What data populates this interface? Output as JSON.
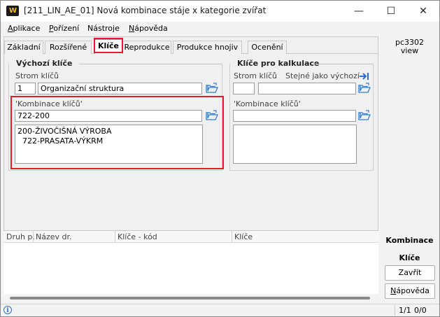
{
  "window": {
    "title": "[211_LIN_AE_01] Nová kombinace stáje x kategorie zvířat",
    "logo": "W",
    "minimize_glyph": "—",
    "maximize_glyph": "☐",
    "close_glyph": "✕"
  },
  "menu": {
    "aplikace": {
      "ul": "A",
      "rest": "plikace"
    },
    "porizeni": {
      "ul": "P",
      "rest": "ořízení"
    },
    "nastroje": {
      "pre": "Nástro",
      "ul": "j",
      "rest": "e"
    },
    "napoveda": {
      "ul": "N",
      "rest": "ápověda"
    }
  },
  "tabs": [
    "Základní",
    "Rozšířené",
    "Klíče",
    "Reprodukce",
    "Produkce hnojiv",
    "Ocenění"
  ],
  "vychozi": {
    "title": "Výchozí klíče",
    "strom_label": "Strom klíčů",
    "strom_code": "1",
    "strom_name": "Organizační struktura",
    "kombinace_label": "'Kombinace klíčů'",
    "kombinace_value": "722-200",
    "kombinace_tree": "200-ŽIVOČIŠNÁ VÝROBA\n  722-PRASATA-VÝKRM"
  },
  "kalkulace": {
    "title": "Klíče pro kalkulace",
    "strom_label": "Strom klíčů",
    "stejne_label": "Stejné jako výchozí",
    "strom_code": "",
    "strom_name": "",
    "kombinace_label": "'Kombinace klíčů'",
    "kombinace_value": "",
    "kombinace_tree": ""
  },
  "table": {
    "columns": [
      "Druh p.",
      "Název dr.",
      "Klíče - kód",
      "Klíče"
    ]
  },
  "side": {
    "user": "pc3302",
    "view": "view",
    "section": "Kombinace",
    "subsection": "Klíče",
    "close_label": "Zavřít",
    "help_ul": "N",
    "help_rest": "ápověda"
  },
  "status": {
    "info_glyph": "i",
    "records": "1/1",
    "changes": "0/0"
  },
  "colors": {
    "highlight": "#e21d2b",
    "folder": "#2f7fd0",
    "arrow": "#2f6fc4"
  }
}
